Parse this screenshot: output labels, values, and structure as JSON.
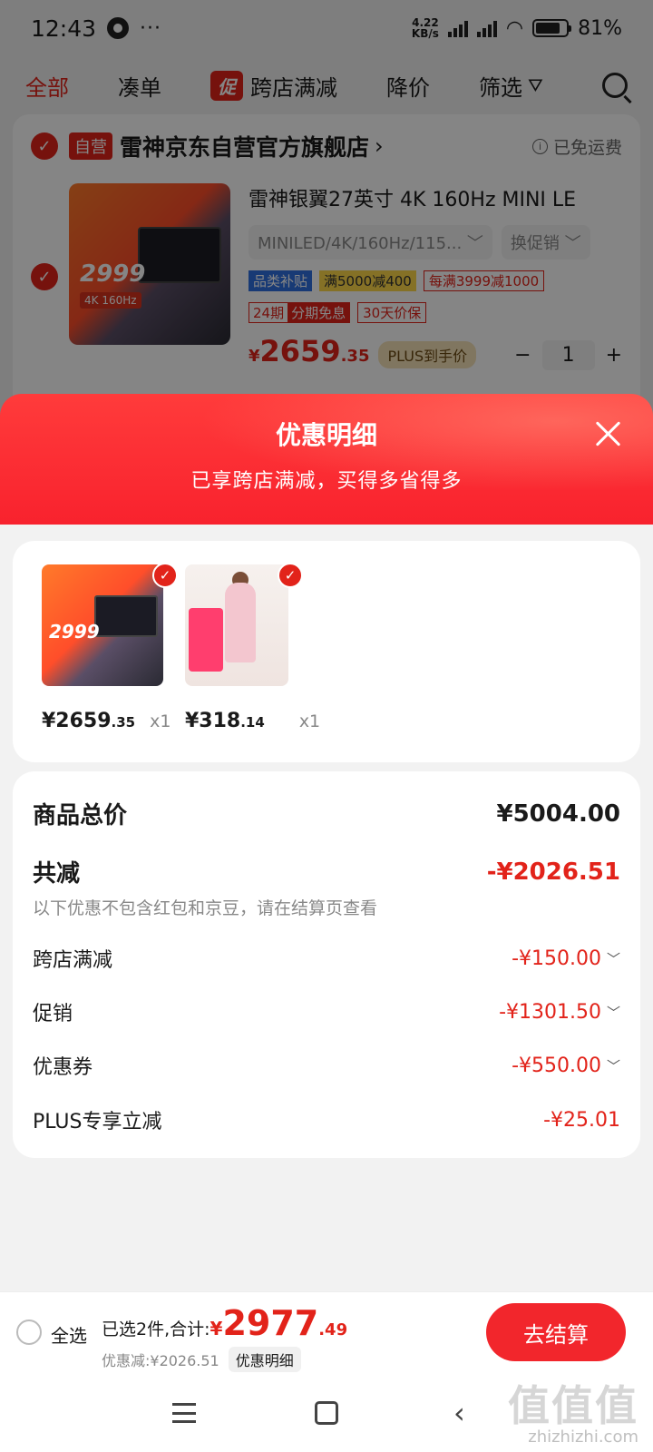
{
  "status_bar": {
    "time": "12:43",
    "net_speed_value": "4.22",
    "net_speed_unit": "KB/s",
    "battery": "81%",
    "battery_level": 0.81,
    "icons": [
      "app-notification-icon",
      "more-icon",
      "signal-icon",
      "wifi-icon",
      "battery-icon"
    ]
  },
  "tabs": [
    {
      "label": "全部",
      "active": true
    },
    {
      "label": "凑单"
    },
    {
      "label": "跨店满减",
      "badge": "促"
    },
    {
      "label": "降价"
    },
    {
      "label": "筛选"
    }
  ],
  "store": {
    "self_badge": "自营",
    "name": "雷神京东自营官方旗舰店",
    "chevron": "›",
    "free_shipping": "已免运费"
  },
  "product": {
    "thumb_price": "2999",
    "thumb_tag": "4K 160Hz",
    "title": "雷神银翼27英寸 4K 160Hz  MINI LE",
    "spec": "MINILED/4K/160Hz/115...",
    "promo_switch": "换促销",
    "tags": {
      "subsidy": "品类补贴",
      "full_reduce": "满5000减400",
      "every_reduce": "每满3999减1000",
      "installment_period": "24期",
      "installment": "分期免息",
      "price_protect": "30天价保"
    },
    "price_currency": "¥",
    "price_int": "2659",
    "price_dec": ".35",
    "plus_badge": "PLUS到手价",
    "minus": "−",
    "quantity": "1",
    "plus": "+"
  },
  "sheet": {
    "title": "优惠明细",
    "subtitle": "已享跨店满减，买得多省得多"
  },
  "items": [
    {
      "price_int": "¥2659",
      "price_dec": ".35",
      "qty": "x1"
    },
    {
      "price_int": "¥318",
      "price_dec": ".14",
      "qty": "x1"
    }
  ],
  "summary": {
    "total_label": "商品总价",
    "total_value": "¥5004.00",
    "reduce_label": "共减",
    "reduce_value": "-¥2026.51",
    "note": "以下优惠不包含红包和京豆，请在结算页查看",
    "lines": [
      {
        "label": "跨店满减",
        "value": "-¥150.00",
        "chevron": "﹀"
      },
      {
        "label": "促销",
        "value": "-¥1301.50",
        "chevron": "﹀"
      },
      {
        "label": "优惠券",
        "value": "-¥550.00",
        "chevron": "﹀"
      },
      {
        "label": "PLUS专享立减",
        "value": "-¥25.01",
        "chevron": ""
      }
    ]
  },
  "checkout": {
    "select_all": "全选",
    "summary_label": "已选2件,合计:",
    "total_currency": "¥",
    "total_int": "2977",
    "total_dec": ".49",
    "discount": "优惠减:¥2026.51",
    "detail_chip": "优惠明细",
    "button": "去结算"
  },
  "watermark": {
    "mark": "值值值",
    "url": "zhizhizhi.com"
  },
  "colors": {
    "accent": "#e2231a",
    "sheet_header": "#f8212d",
    "checkout_button": "#f2262c"
  }
}
